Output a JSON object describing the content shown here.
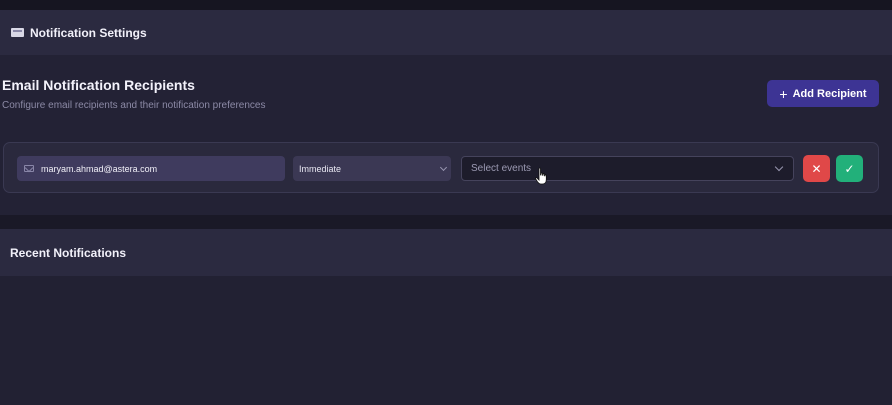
{
  "header": {
    "icon": "envelope-icon",
    "title": "Notification Settings"
  },
  "recipients_section": {
    "title": "Email Notification Recipients",
    "subtitle": "Configure email recipients and their notification preferences",
    "add_button_label": "Add Recipient",
    "add_button_icon": "plus-icon"
  },
  "recipient_row": {
    "email_icon": "mail-icon",
    "email": "maryam.ahmad@astera.com",
    "frequency": "Immediate",
    "events_placeholder": "Select events",
    "delete_icon": "close-icon",
    "confirm_icon": "check-icon"
  },
  "recent_section": {
    "title": "Recent Notifications"
  },
  "colors": {
    "accent": "#3d3494",
    "danger": "#e04848",
    "success": "#22b07a",
    "background": "#1a1927"
  }
}
